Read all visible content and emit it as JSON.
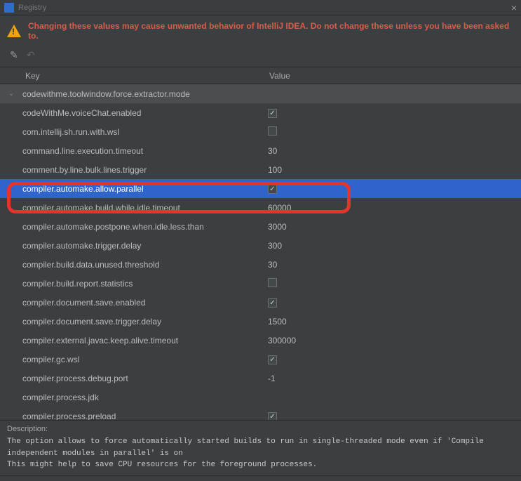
{
  "window": {
    "title": "Registry"
  },
  "warning": "Changing these values may cause unwanted behavior of IntelliJ IDEA. Do not change these unless you have been asked to.",
  "columns": {
    "key": "Key",
    "value": "Value"
  },
  "modified_header": "codewithme.toolwindow.force.extractor.mode",
  "rows": [
    {
      "key": "codeWithMe.voiceChat.enabled",
      "type": "check",
      "checked": true
    },
    {
      "key": "com.intellij.sh.run.with.wsl",
      "type": "check",
      "checked": false
    },
    {
      "key": "command.line.execution.timeout",
      "type": "text",
      "value": "30"
    },
    {
      "key": "comment.by.line.bulk.lines.trigger",
      "type": "text",
      "value": "100"
    },
    {
      "key": "compiler.automake.allow.parallel",
      "type": "check",
      "checked": true,
      "selected": true
    },
    {
      "key": "compiler.automake.build.while.idle.timeout",
      "type": "text",
      "value": "60000"
    },
    {
      "key": "compiler.automake.postpone.when.idle.less.than",
      "type": "text",
      "value": "3000"
    },
    {
      "key": "compiler.automake.trigger.delay",
      "type": "text",
      "value": "300"
    },
    {
      "key": "compiler.build.data.unused.threshold",
      "type": "text",
      "value": "30"
    },
    {
      "key": "compiler.build.report.statistics",
      "type": "check",
      "checked": false
    },
    {
      "key": "compiler.document.save.enabled",
      "type": "check",
      "checked": true
    },
    {
      "key": "compiler.document.save.trigger.delay",
      "type": "text",
      "value": "1500"
    },
    {
      "key": "compiler.external.javac.keep.alive.timeout",
      "type": "text",
      "value": "300000"
    },
    {
      "key": "compiler.gc.wsl",
      "type": "check",
      "checked": true
    },
    {
      "key": "compiler.process.debug.port",
      "type": "text",
      "value": "-1"
    },
    {
      "key": "compiler.process.jdk",
      "type": "text",
      "value": ""
    },
    {
      "key": "compiler.process.preload",
      "type": "check",
      "checked": true
    }
  ],
  "description": {
    "label": "Description:",
    "body": "The option allows to force automatically started builds to run in single-threaded mode even if 'Compile independent modules in parallel' is on\nThis might help to save CPU resources for the foreground processes."
  }
}
